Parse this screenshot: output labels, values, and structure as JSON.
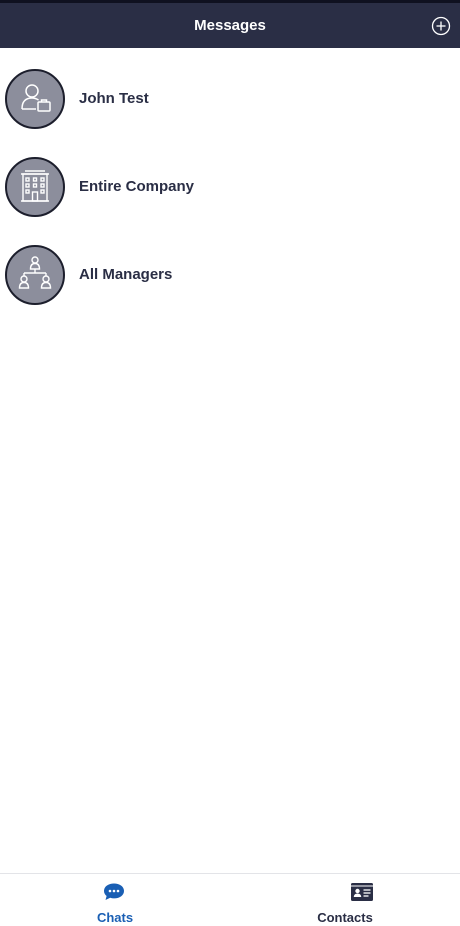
{
  "header": {
    "title": "Messages",
    "add_icon": "plus-circle-icon"
  },
  "chats": [
    {
      "name": "John Test",
      "icon": "person-briefcase-icon"
    },
    {
      "name": "Entire Company",
      "icon": "building-icon"
    },
    {
      "name": "All Managers",
      "icon": "org-chart-icon"
    }
  ],
  "tabs": [
    {
      "label": "Chats",
      "icon": "chat-bubble-icon",
      "active": true
    },
    {
      "label": "Contacts",
      "icon": "contact-card-icon",
      "active": false
    }
  ],
  "colors": {
    "header_bg": "#2a2e45",
    "avatar_bg": "#8c8e9c",
    "active_tab": "#1a5fb4",
    "inactive_tab": "#2a2e45",
    "text": "#2a2e45"
  }
}
